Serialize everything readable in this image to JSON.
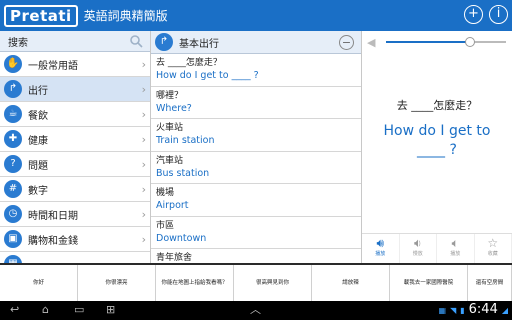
{
  "header": {
    "logo": "Pretati",
    "title": "英語詞典精簡版",
    "add_icon": "plus-circle-icon",
    "info_icon": "info-circle-icon"
  },
  "sidebar": {
    "search_label": "搜索",
    "items": [
      {
        "label": "一般常用語",
        "icon": "hand-icon"
      },
      {
        "label": "出行",
        "icon": "direction-icon"
      },
      {
        "label": "餐飲",
        "icon": "dining-icon"
      },
      {
        "label": "健康",
        "icon": "health-icon"
      },
      {
        "label": "問題",
        "icon": "question-icon"
      },
      {
        "label": "數字",
        "icon": "numbers-icon"
      },
      {
        "label": "時間和日期",
        "icon": "clock-icon"
      },
      {
        "label": "購物和金錢",
        "icon": "shopping-icon"
      },
      {
        "label": "",
        "icon": "calendar-icon"
      }
    ]
  },
  "phrase_list": {
    "heading": "基本出行",
    "items": [
      {
        "zh": "去 ____怎麼走？",
        "en": "How do I get to ____ ?"
      },
      {
        "zh": "哪裡？",
        "en": "Where?"
      },
      {
        "zh": "火車站",
        "en": "Train station"
      },
      {
        "zh": "汽車站",
        "en": "Bus station"
      },
      {
        "zh": "機場",
        "en": "Airport"
      },
      {
        "zh": "市區",
        "en": "Downtown"
      },
      {
        "zh": "青年旅舍",
        "en": ""
      }
    ]
  },
  "detail": {
    "progress": 0.7,
    "zh": "去 ____怎麼走？",
    "en": "How do I get to ____ ?",
    "tools": [
      {
        "label": "播放",
        "icon": "speaker-icon",
        "active": true
      },
      {
        "label": "慢放",
        "icon": "slow-speaker-icon",
        "active": false
      },
      {
        "label": "播放",
        "icon": "speaker-icon",
        "active": false
      },
      {
        "label": "收藏",
        "icon": "star-icon",
        "active": false
      }
    ]
  },
  "quick_phrases": [
    "你好",
    "你很漂亮",
    "你能在地圖上指給我看嗎？",
    "很高興見到你",
    "請放辣",
    "載我去一家國際醫院",
    "還有空房間"
  ],
  "system": {
    "time": "6:44"
  },
  "colors": {
    "brand": "#1a6fc6",
    "selected_row": "#d5e3f4"
  }
}
